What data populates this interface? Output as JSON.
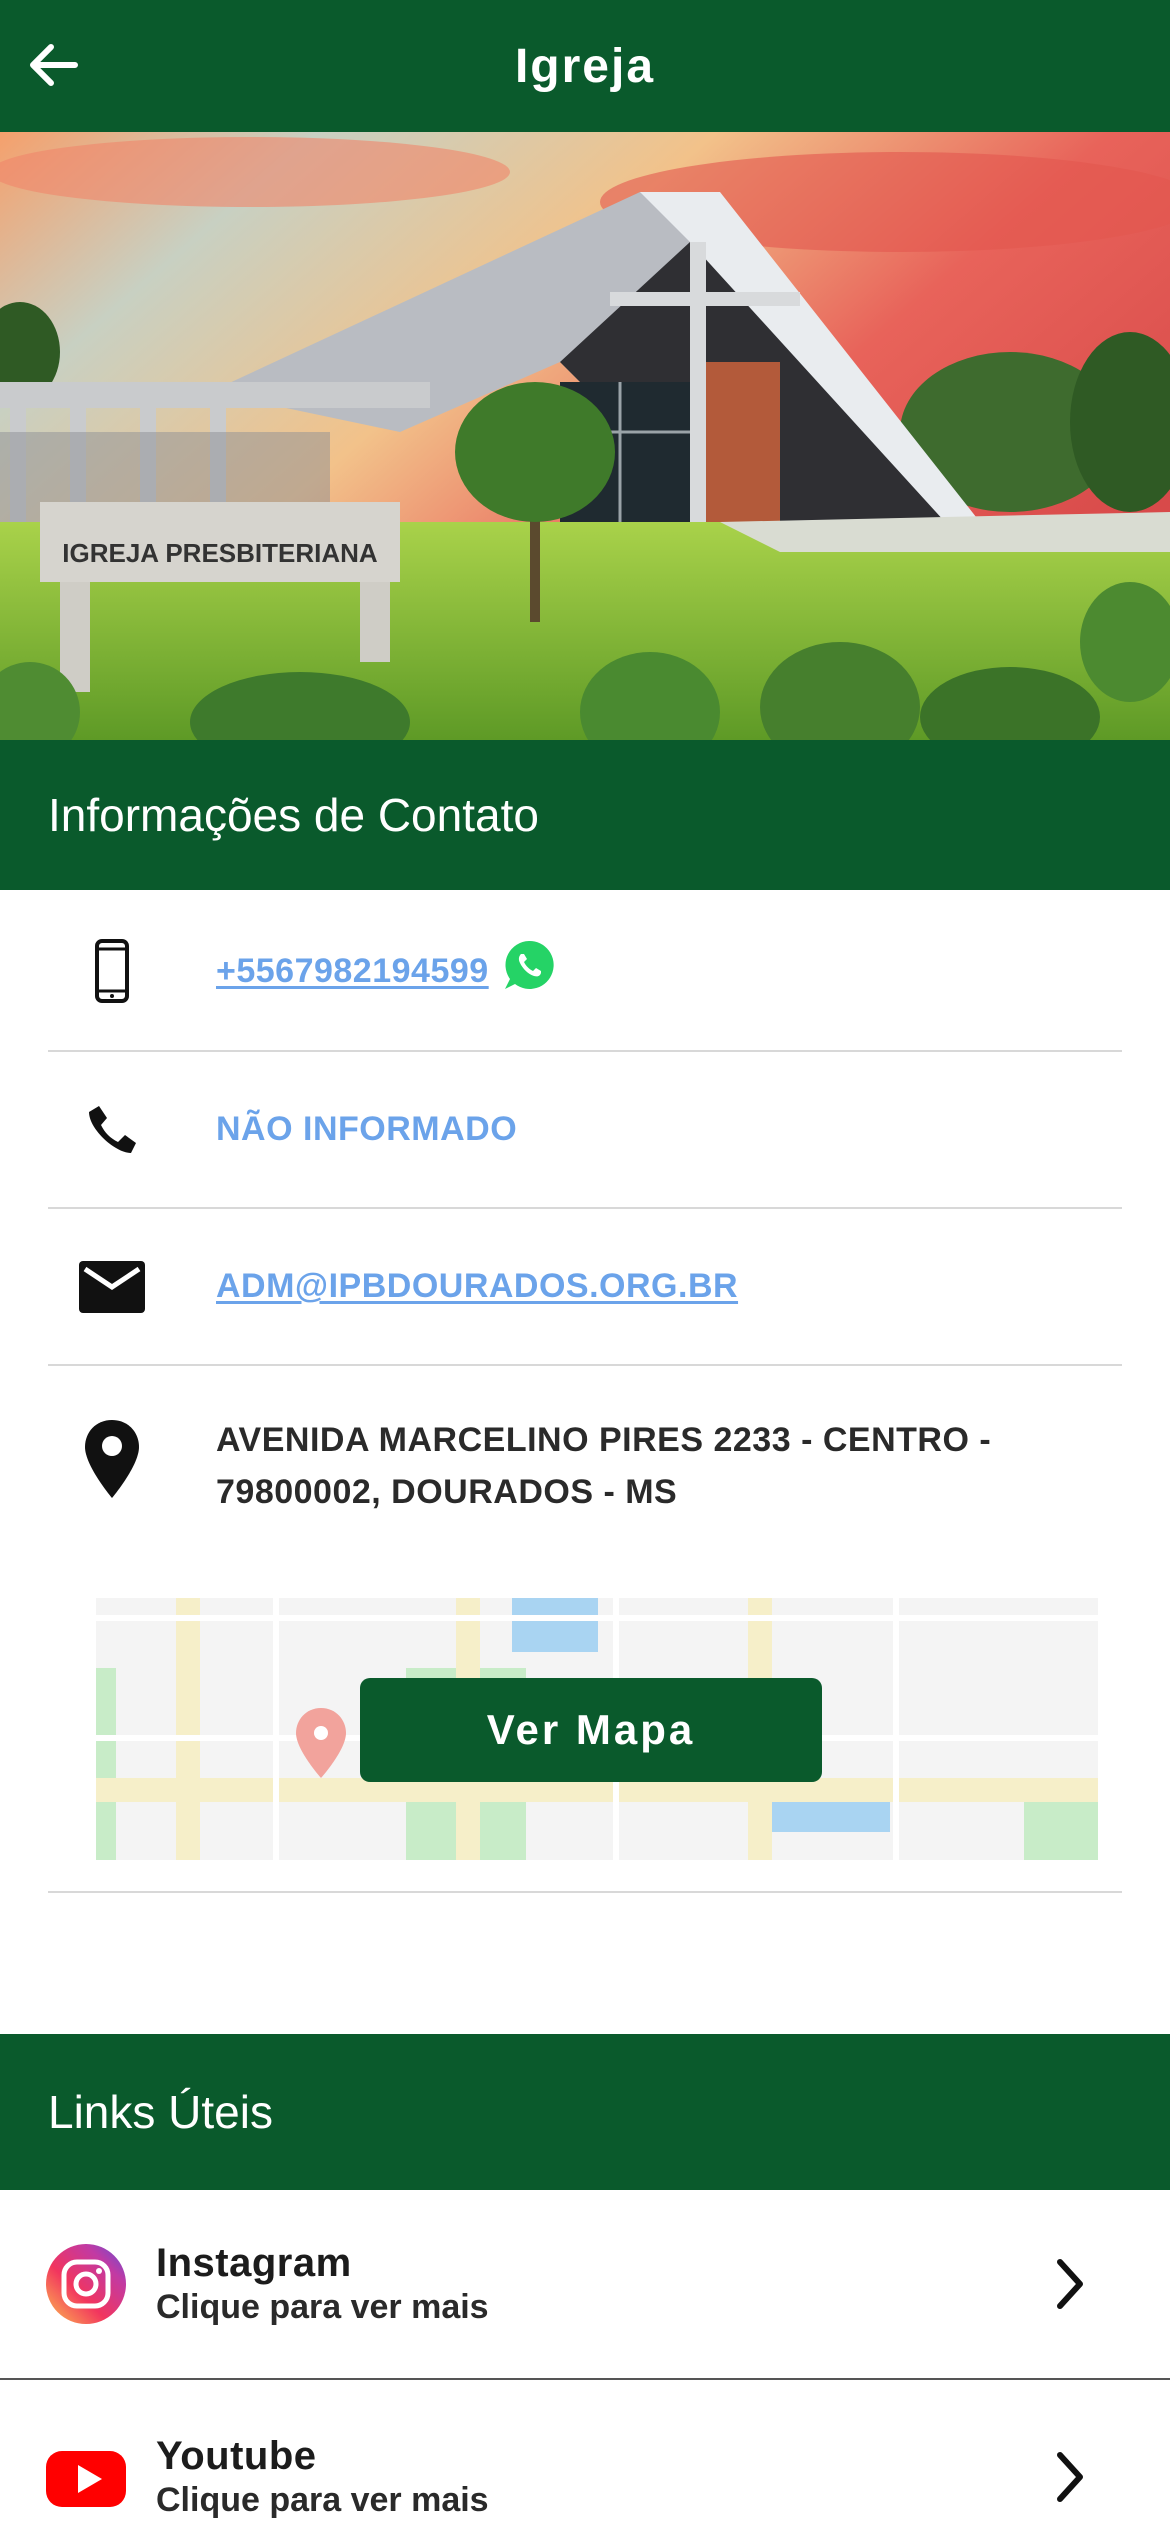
{
  "header": {
    "title": "Igreja",
    "back_icon": "arrow-left-icon"
  },
  "hero": {
    "sign_text": "IGREJA PRESBITERIANA"
  },
  "contact": {
    "section_title": "Informações de Contato",
    "mobile": {
      "icon": "smartphone-icon",
      "value": "+5567982194599 ",
      "whatsapp_icon": "whatsapp-icon"
    },
    "phone": {
      "icon": "phone-icon",
      "value": "NÃO INFORMADO"
    },
    "email": {
      "icon": "mail-icon",
      "value": "ADM@IPBDOURADOS.ORG.BR"
    },
    "address": {
      "icon": "map-pin-icon",
      "value": "AVENIDA MARCELINO PIRES 2233 - CENTRO - 79800002, DOURADOS - MS"
    },
    "map_button_label": "Ver Mapa"
  },
  "links": {
    "section_title": "Links Úteis",
    "items": [
      {
        "title": "Instagram",
        "subtitle": "Clique para ver mais",
        "icon": "instagram-icon"
      },
      {
        "title": "Youtube",
        "subtitle": "Clique para ver mais",
        "icon": "youtube-icon"
      }
    ]
  },
  "colors": {
    "brand_green": "#0a5a2c",
    "link_blue": "#6ba3ea",
    "whatsapp_green": "#25d366",
    "youtube_red": "#ff0000"
  }
}
